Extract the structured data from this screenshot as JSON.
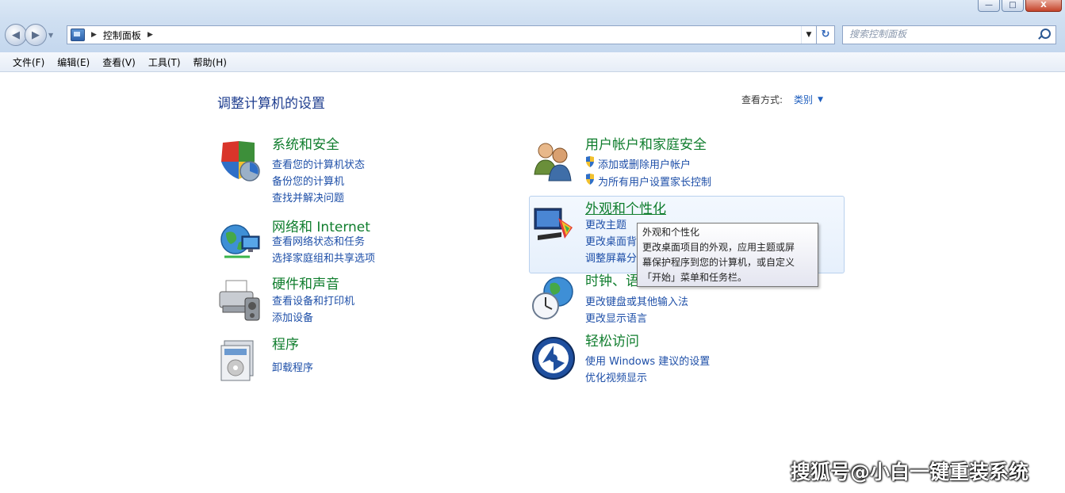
{
  "window": {
    "buttons": [
      "—",
      "□",
      "X"
    ]
  },
  "address_bar": {
    "breadcrumb": "控制面板"
  },
  "search": {
    "placeholder": "搜索控制面板"
  },
  "menu": [
    "文件(F)",
    "编辑(E)",
    "查看(V)",
    "工具(T)",
    "帮助(H)"
  ],
  "page_title": "调整计算机的设置",
  "view_by": {
    "label": "查看方式:",
    "value": "类别"
  },
  "categories": {
    "system_security": {
      "title": "系统和安全",
      "links": [
        "查看您的计算机状态",
        "备份您的计算机",
        "查找并解决问题"
      ]
    },
    "network": {
      "title": "网络和 Internet",
      "links": [
        "查看网络状态和任务",
        "选择家庭组和共享选项"
      ]
    },
    "hardware_sound": {
      "title": "硬件和声音",
      "links": [
        "查看设备和打印机",
        "添加设备"
      ]
    },
    "programs": {
      "title": "程序",
      "links": [
        "卸载程序"
      ]
    },
    "user_accounts": {
      "title": "用户帐户和家庭安全",
      "links": [
        "添加或删除用户帐户",
        "为所有用户设置家长控制"
      ]
    },
    "appearance": {
      "title": "外观和个性化",
      "links": [
        "更改主题",
        "更改桌面背",
        "调整屏幕分"
      ]
    },
    "clock": {
      "title": "时钟、语",
      "links": [
        "更改键盘或其他输入法",
        "更改显示语言"
      ]
    },
    "ease": {
      "title": "轻松访问",
      "links": [
        "使用 Windows 建议的设置",
        "优化视频显示"
      ]
    }
  },
  "tooltip": {
    "lines": [
      "外观和个性化",
      "更改桌面项目的外观，应用主题或屏",
      "幕保护程序到您的计算机，或自定义",
      "「开始」菜单和任务栏。"
    ]
  },
  "watermark": "搜狐号@小白一键重装系统"
}
